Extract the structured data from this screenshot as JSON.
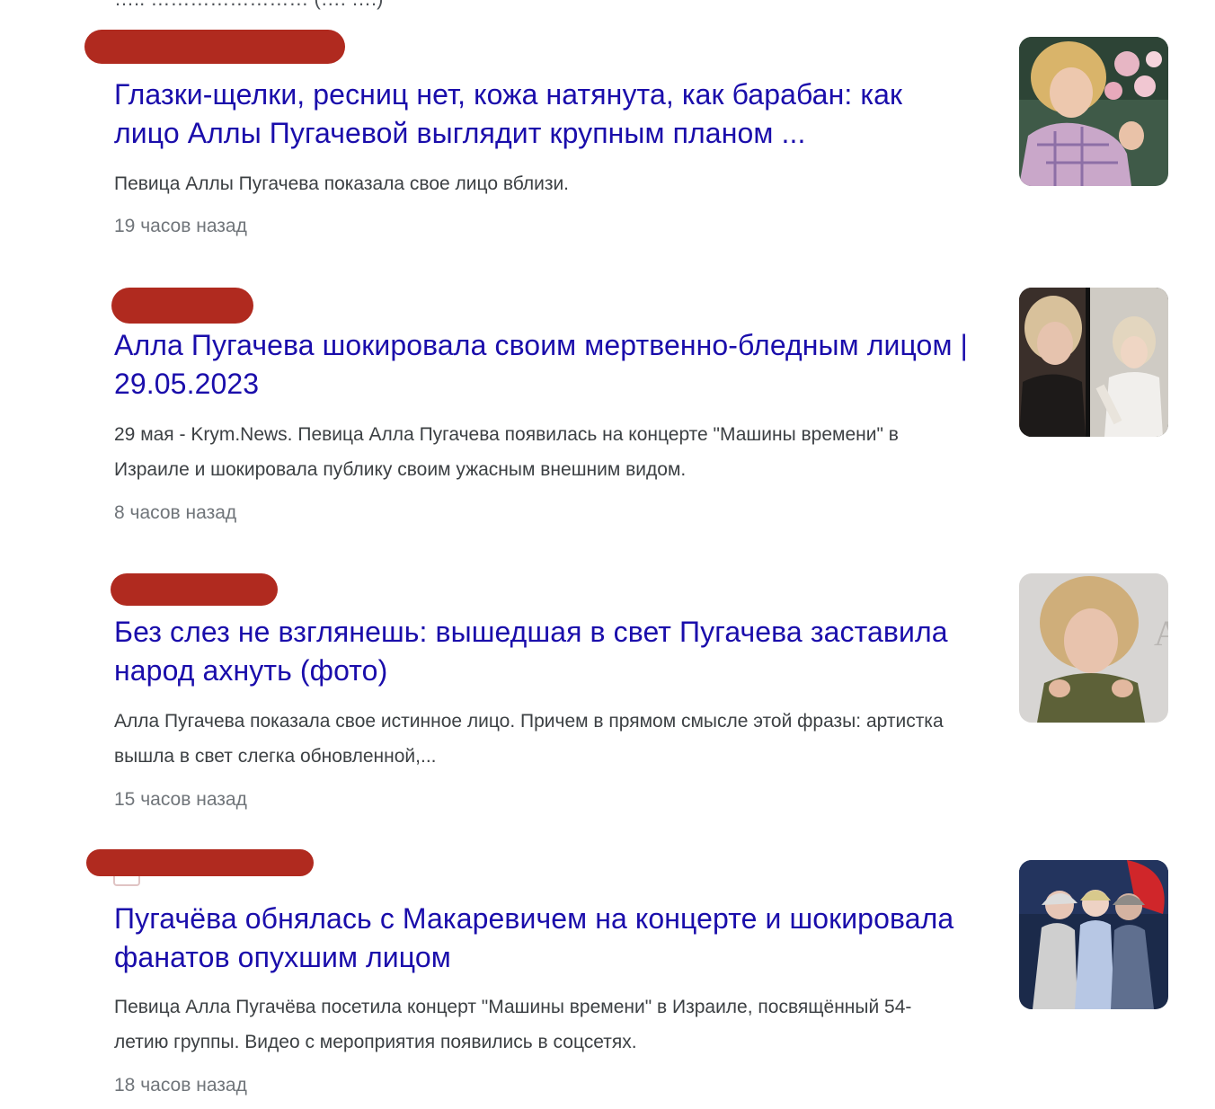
{
  "top_cut_text": "….. …………………… (…. ….)",
  "results": [
    {
      "title": "Глазки-щелки, ресниц нет, кожа натянута, как барабан: как лицо Аллы Пугачевой выглядит крупным планом ...",
      "snippet": "Певица Аллы Пугачева показала свое лицо вблизи.",
      "time": "19 часов назад",
      "thumbnail": "photo-alla-pugacheva-flowers"
    },
    {
      "title": "Алла Пугачева шокировала своим мертвенно-бледным лицом | 29.05.2023",
      "snippet": "29 мая - Krym.News. Певица Алла Пугачева появилась на концерте \"Машины времени\" в Израиле и шокировала публику своим ужасным внешним видом.",
      "time": "8 часов назад",
      "thumbnail": "photo-alla-pugacheva-collage"
    },
    {
      "title": "Без слез не взглянешь: вышедшая в свет Пугачева заставила народ ахнуть (фото)",
      "snippet": "Алла Пугачева показала свое истинное лицо. Причем в прямом смысле этой фразы: артистка вышла в свет слегка обновленной,...",
      "time": "15 часов назад",
      "thumbnail": "photo-alla-pugacheva-portrait"
    },
    {
      "title": "Пугачёва обнялась с Макаревичем на концерте и шокировала фанатов опухшим лицом",
      "snippet": "Певица Алла Пугачёва посетила концерт \"Машины времени\" в Израиле, посвящённый 54-летию группы. Видео с мероприятия появились в соцсетях.",
      "time": "18 часов назад",
      "thumbnail": "photo-concert-hug"
    }
  ],
  "colors": {
    "title_link": "#1a0dab",
    "snippet": "#3c4043",
    "time": "#70757a",
    "redaction": "#b02a1f"
  }
}
